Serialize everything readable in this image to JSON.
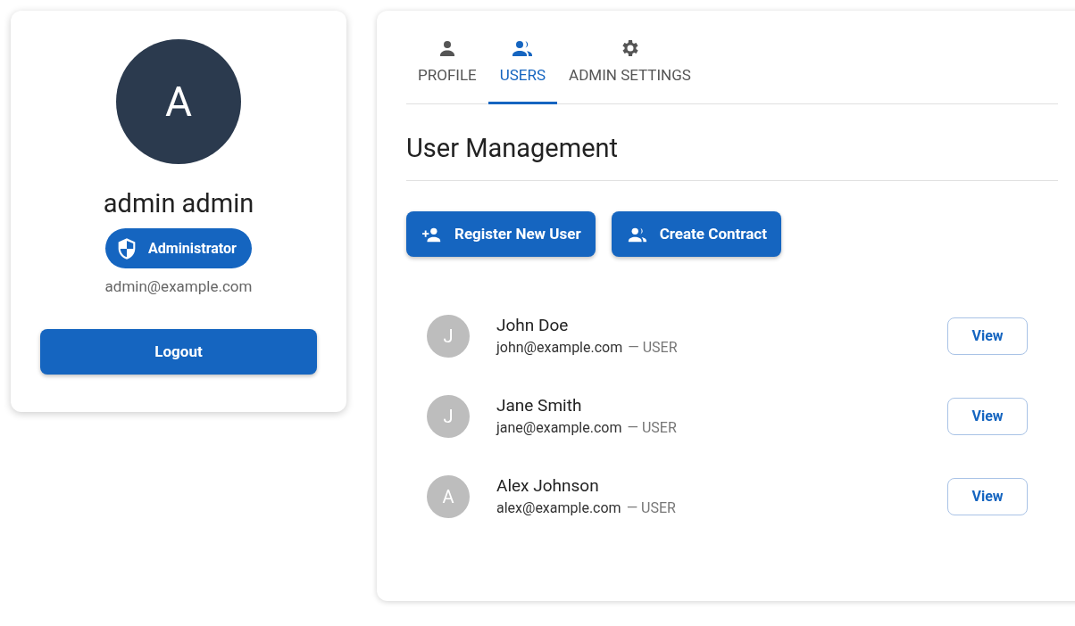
{
  "profile": {
    "avatar_letter": "A",
    "name": "admin admin",
    "role_badge": "Administrator",
    "email": "admin@example.com",
    "logout_button": "Logout"
  },
  "tabs": [
    {
      "label": "PROFILE",
      "selected": false
    },
    {
      "label": "USERS",
      "selected": true
    },
    {
      "label": "ADMIN SETTINGS",
      "selected": false
    }
  ],
  "heading": "User Management",
  "actions": [
    "Register New User",
    "Create Contract"
  ],
  "users": [
    {
      "initial": "J",
      "name": "John Doe",
      "email": "john@example.com",
      "role": "— USER",
      "action": "View"
    },
    {
      "initial": "J",
      "name": "Jane Smith",
      "email": "jane@example.com",
      "role": "— USER",
      "action": "View"
    },
    {
      "initial": "A",
      "name": "Alex Johnson",
      "email": "alex@example.com",
      "role": "— USER",
      "action": "View"
    }
  ]
}
